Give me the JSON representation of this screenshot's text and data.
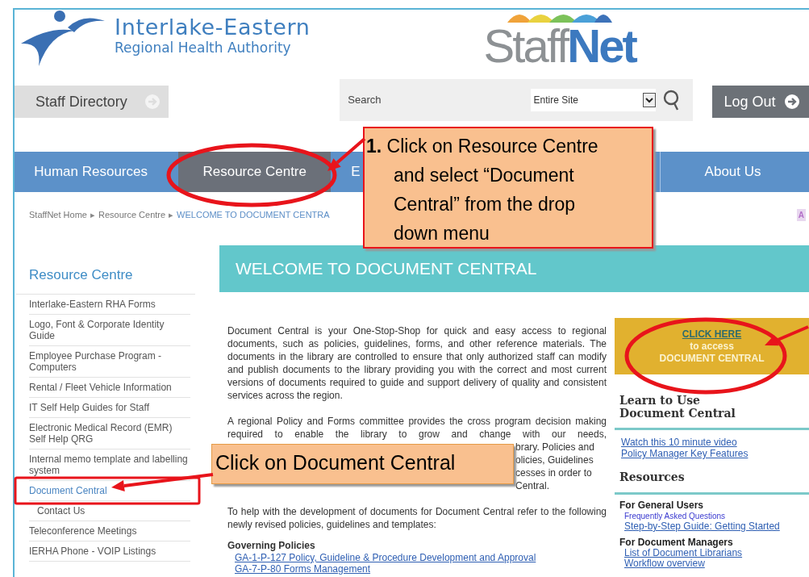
{
  "header": {
    "org_name": "Interlake-Eastern",
    "org_subtitle": "Regional Health Authority",
    "site_logo": [
      "Staff",
      "Net"
    ]
  },
  "toolbar": {
    "staff_directory": "Staff Directory",
    "search_label": "Search",
    "search_scope": "Entire Site",
    "logout": "Log Out"
  },
  "nav": [
    {
      "label": "Human Resources",
      "selected": false
    },
    {
      "label": "Resource Centre",
      "selected": true
    },
    {
      "label": "E",
      "selected": false
    },
    {
      "label": "About Us",
      "selected": false
    }
  ],
  "breadcrumb_separator": "▸",
  "breadcrumb": [
    "StaffNet Home",
    "Resource Centre",
    "WELCOME TO DOCUMENT CENTRA"
  ],
  "text_size_label": "A",
  "sidebar": {
    "title": "Resource Centre",
    "items": [
      {
        "label": "Interlake-Eastern RHA Forms",
        "selected": false
      },
      {
        "label": "Logo, Font & Corporate Identity Guide",
        "selected": false
      },
      {
        "label": "Employee Purchase Program - Computers",
        "selected": false
      },
      {
        "label": "Rental / Fleet Vehicle Information",
        "selected": false
      },
      {
        "label": "IT Self Help Guides for Staff",
        "selected": false
      },
      {
        "label": "Electronic Medical Record (EMR) Self Help QRG",
        "selected": false
      },
      {
        "label": "Internal memo template and labelling system",
        "selected": false
      },
      {
        "label": "Document Central",
        "selected": true,
        "children": [
          {
            "label": "Contact Us",
            "selected": false
          }
        ]
      },
      {
        "label": "Teleconference Meetings",
        "selected": false
      },
      {
        "label": "IERHA Phone - VOIP Listings",
        "selected": false
      }
    ]
  },
  "banner_title": "WELCOME TO DOCUMENT CENTRAL",
  "main": {
    "paragraph_1": "Document Central is your One-Stop-Shop for quick and easy access to regional documents, such as policies, guidelines, forms, and other reference materials. The documents in the library are controlled to ensure that only authorized staff can modify and publish documents to the library providing you with the correct and most current versions of documents required to guide and support delivery of quality and consistent services across the region.",
    "paragraph_2": "A regional Policy and Forms committee provides the cross program decision making required to enable the library to grow and change with our needs,",
    "paragraph_2_fragments": [
      "brary. Policies and",
      "olicies, Guidelines",
      "cesses in order to",
      "Central."
    ],
    "paragraph_3": "To help with the development of documents for Document Central refer to the following newly revised policies, guidelines and templates:",
    "governing_title": "Governing Policies",
    "governing_links": [
      "GA-1-P-127 Policy, Guideline & Procedure Development and Approval",
      "GA-7-P-80 Forms Management"
    ]
  },
  "aside": {
    "access_box": {
      "link": "CLICK HERE",
      "line_2": "to access",
      "line_3": "DOCUMENT CENTRAL"
    },
    "learn_title": "Learn to Use Document Central",
    "learn_links": [
      "Watch this 10 minute video",
      "Policy Manager Key Features"
    ],
    "resources_title": "Resources",
    "groups": [
      {
        "title": "For General Users",
        "links": [
          {
            "label": "Frequently Asked Questions",
            "kind": "small"
          },
          {
            "label": "Step-by-Step Guide: Getting Started",
            "kind": "underlined"
          }
        ]
      },
      {
        "title": "For Document Managers",
        "links": [
          {
            "label": "List of Document Librarians",
            "kind": "underlined"
          },
          {
            "label": "Workflow overview",
            "kind": "underlined"
          }
        ]
      }
    ]
  },
  "callouts": [
    "**1.** Click on Resource Centre and select “Document Central” from the drop down menu",
    "Click on Document Central"
  ]
}
